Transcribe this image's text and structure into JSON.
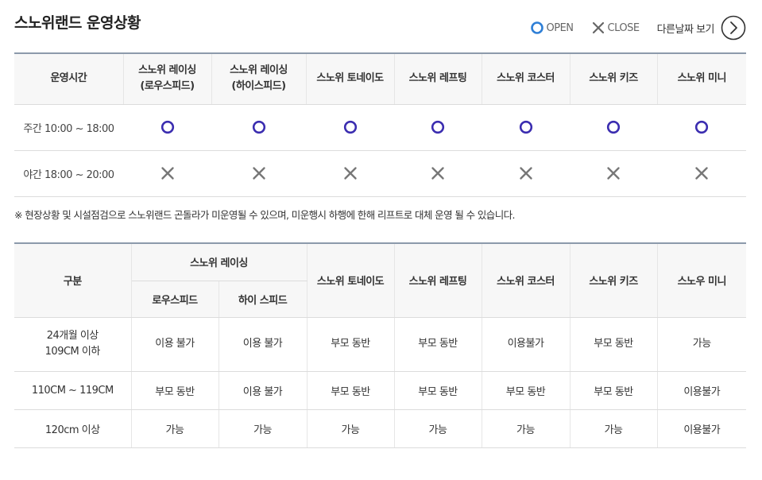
{
  "page": {
    "title": "스노위랜드 운영상황",
    "legend": {
      "open_label": "OPEN",
      "close_label": "CLOSE"
    },
    "other_date_label": "다른날짜 보기"
  },
  "status_table": {
    "headers": [
      "운영시간",
      "스노위 레이싱\n(로우스피드)",
      "스노위 레이싱\n(하이스피드)",
      "스노위 토네이도",
      "스노위 레프팅",
      "스노위 코스터",
      "스노위 키즈",
      "스노위 미니"
    ],
    "rows": [
      {
        "label": "주간 10:00 ~ 18:00",
        "status": [
          "open",
          "open",
          "open",
          "open",
          "open",
          "open",
          "open"
        ]
      },
      {
        "label": "야간 18:00 ~ 20:00",
        "status": [
          "close",
          "close",
          "close",
          "close",
          "close",
          "close",
          "close"
        ]
      }
    ]
  },
  "note": "※ 현장상황 및 시설점검으로 스노위랜드 곤돌라가 미운영될 수 있으며, 미운행시 하행에 한해 리프트로 대체 운영 될 수 있습니다.",
  "age_table": {
    "category_header": "구분",
    "group_header": "스노위 레이싱",
    "sub_headers": [
      "로우스피드",
      "하이 스피드"
    ],
    "other_headers": [
      "스노위 토네이도",
      "스노위 레프팅",
      "스노위 코스터",
      "스노위 키즈",
      "스노우 미니"
    ],
    "rows": [
      {
        "label": "24개월 이상\n109CM 이하",
        "cells": [
          "이용 불가",
          "이용 불가",
          "부모 동반",
          "부모 동반",
          "이용불가",
          "부모 동반",
          "가능"
        ]
      },
      {
        "label": "110CM ~ 119CM",
        "cells": [
          "부모 동반",
          "이용 불가",
          "부모 동반",
          "부모 동반",
          "부모 동반",
          "부모 동반",
          "이용불가"
        ]
      },
      {
        "label": "120cm 이상",
        "cells": [
          "가능",
          "가능",
          "가능",
          "가능",
          "가능",
          "가능",
          "이용불가"
        ]
      }
    ]
  },
  "colors": {
    "open": "#3b2db0",
    "close": "#777777",
    "header_bg": "#f7f7f7",
    "top_border": "#8c9aab"
  }
}
